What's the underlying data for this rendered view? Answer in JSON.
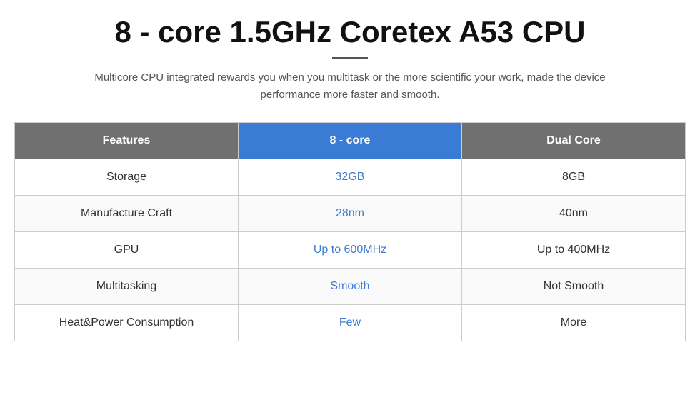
{
  "page": {
    "title": "8 - core 1.5GHz Coretex A53 CPU",
    "subtitle": "Multicore CPU integrated rewards you when you multitask or the more scientific your work, made the device performance more faster and smooth.",
    "divider": ""
  },
  "table": {
    "headers": {
      "features": "Features",
      "core8": "8 - core",
      "dualcore": "Dual Core"
    },
    "rows": [
      {
        "feature": "Storage",
        "value_8core": "32GB",
        "value_dual": "8GB"
      },
      {
        "feature": "Manufacture Craft",
        "value_8core": "28nm",
        "value_dual": "40nm"
      },
      {
        "feature": "GPU",
        "value_8core": "Up to 600MHz",
        "value_dual": "Up to 400MHz"
      },
      {
        "feature": "Multitasking",
        "value_8core": "Smooth",
        "value_dual": "Not Smooth"
      },
      {
        "feature": "Heat&Power Consumption",
        "value_8core": "Few",
        "value_dual": "More"
      }
    ]
  }
}
